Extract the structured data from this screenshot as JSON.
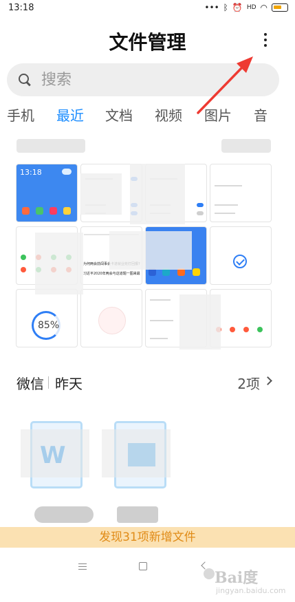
{
  "status_bar": {
    "time": "13:18",
    "icons": [
      "signal-dots",
      "bluetooth-icon",
      "alarm-icon",
      "network-hd-icon",
      "wifi-icon",
      "battery-icon"
    ]
  },
  "header": {
    "title": "文件管理",
    "menu_icon": "more-vertical-icon"
  },
  "search": {
    "placeholder": "搜索"
  },
  "tabs": [
    {
      "label": "手机",
      "active": false
    },
    {
      "label": "最近",
      "active": true
    },
    {
      "label": "文档",
      "active": false
    },
    {
      "label": "视频",
      "active": false
    },
    {
      "label": "图片",
      "active": false
    },
    {
      "label": "音",
      "active": false
    }
  ],
  "thumbnails": {
    "lock_time": "13:18",
    "storage_percent": "85%",
    "news_line_1": "为何两会前闯事会卡进就业抢打回报?",
    "news_line_2": "习近平2020年两会与这道题一图来最"
  },
  "wechat_section": {
    "title": "微信",
    "date": "昨天",
    "count": "2项"
  },
  "documents": [
    {
      "type": "word",
      "glyph": "W"
    },
    {
      "type": "word",
      "glyph": ""
    }
  ],
  "notice": {
    "text": "发现31项新增文件"
  },
  "nav": {
    "icons": [
      "menu-icon",
      "home-icon",
      "back-icon"
    ]
  },
  "watermark": {
    "text": "Bai度",
    "sub": "jingyan.baidu.com"
  },
  "colors": {
    "accent": "#1a8cff",
    "notice_bg": "#fbe1b2",
    "notice_text": "#e08b17",
    "arrow": "#ee3a32"
  }
}
